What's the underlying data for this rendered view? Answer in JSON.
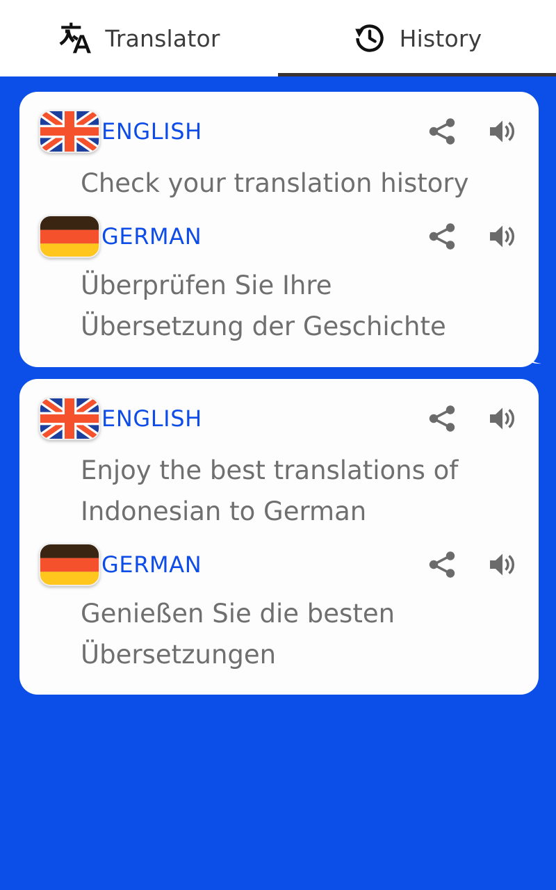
{
  "app": {
    "background_color": "#0b4ee8",
    "card_color": "#fdfdfd",
    "accent_blue": "#0e4ce8",
    "body_text_color": "#6f6f6f",
    "tab_indicator_color": "#3a3331"
  },
  "tabs": [
    {
      "id": "translator",
      "label": "Translator",
      "icon": "translate-icon",
      "selected": false
    },
    {
      "id": "history",
      "label": "History",
      "icon": "history-clock-icon",
      "selected": true
    }
  ],
  "history": {
    "items": [
      {
        "source": {
          "flag": "flag-united-kingdom",
          "language": "ENGLISH",
          "text": "Check your translation history",
          "share_label": "share-icon",
          "speak_label": "volume-icon"
        },
        "target": {
          "flag": "flag-germany",
          "language": "GERMAN",
          "text": "Überprüfen Sie Ihre Übersetzung der Geschichte",
          "share_label": "share-icon",
          "speak_label": "volume-icon"
        }
      },
      {
        "source": {
          "flag": "flag-united-kingdom",
          "language": "ENGLISH",
          "text": "Enjoy the best transla­tions of Indonesian to German",
          "share_label": "share-icon",
          "speak_label": "volume-icon"
        },
        "target": {
          "flag": "flag-germany",
          "language": "GERMAN",
          "text": "Genießen Sie die besten Übersetzungen",
          "share_label": "share-icon",
          "speak_label": "volume-icon"
        }
      }
    ]
  }
}
